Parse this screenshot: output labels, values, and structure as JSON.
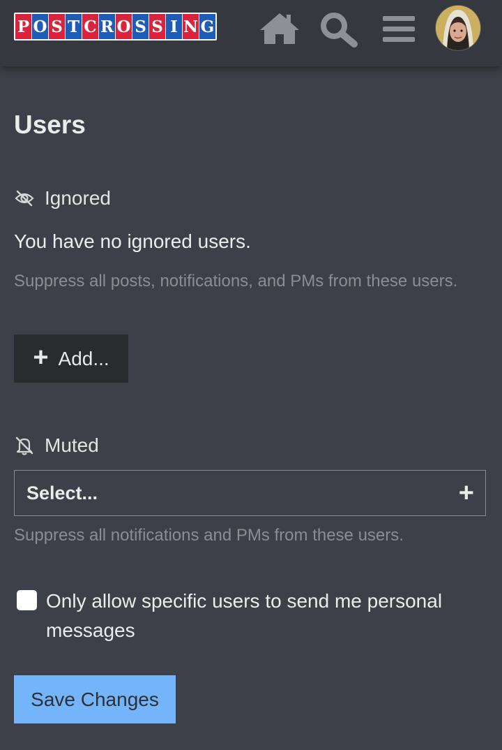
{
  "header": {
    "logo_letters": [
      "P",
      "O",
      "S",
      "T",
      "C",
      "R",
      "O",
      "S",
      "S",
      "I",
      "N",
      "G"
    ],
    "icons": [
      "home-icon",
      "search-icon",
      "menu-icon"
    ],
    "avatar": "user-avatar"
  },
  "page": {
    "title": "Users"
  },
  "ignored": {
    "label": "Ignored",
    "icon": "eye-slash-icon",
    "empty_message": "You have no ignored users.",
    "help": "Suppress all posts, notifications, and PMs from these users.",
    "add_button": "Add..."
  },
  "muted": {
    "label": "Muted",
    "icon": "bell-slash-icon",
    "select_placeholder": "Select...",
    "help": "Suppress all notifications and PMs from these users."
  },
  "pm_setting": {
    "label": "Only allow specific users to send me personal messages",
    "checked": false
  },
  "actions": {
    "save_label": "Save Changes"
  },
  "colors": {
    "background": "#3d4048",
    "header": "#35383f",
    "primary_button": "#73b5f8",
    "logo_red": "#d8243c",
    "logo_blue": "#1f5cb8"
  }
}
